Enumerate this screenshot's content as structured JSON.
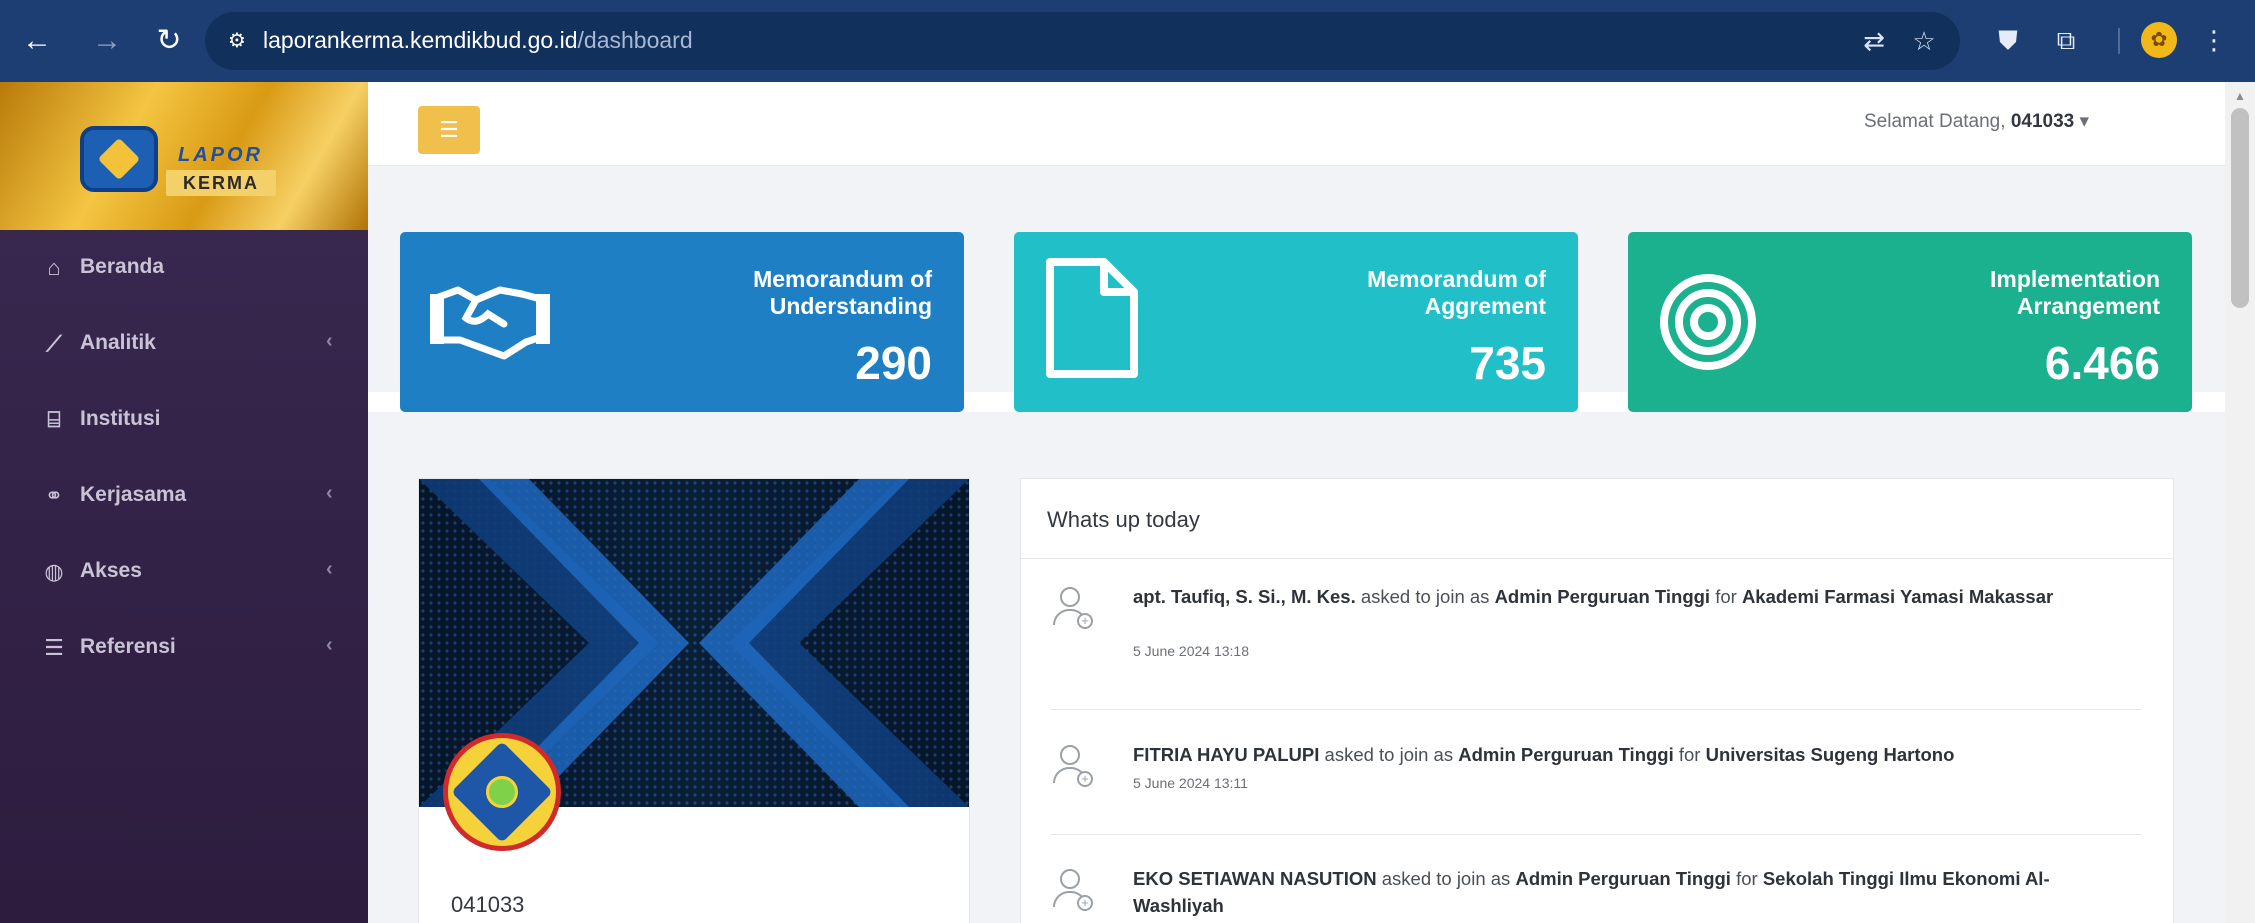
{
  "browser": {
    "url_host": "laporankerma.kemdikbud.go.id",
    "url_path": "/dashboard"
  },
  "logo": {
    "line1": "LAPOR",
    "line2": "KERMA"
  },
  "sidebar": {
    "items": [
      {
        "label": "Beranda",
        "icon": "home-icon",
        "has_submenu": false
      },
      {
        "label": "Analitik",
        "icon": "chart-line-icon",
        "has_submenu": true
      },
      {
        "label": "Institusi",
        "icon": "institution-icon",
        "has_submenu": false
      },
      {
        "label": "Kerjasama",
        "icon": "handshake-icon",
        "has_submenu": true
      },
      {
        "label": "Akses",
        "icon": "globe-icon",
        "has_submenu": true
      },
      {
        "label": "Referensi",
        "icon": "database-icon",
        "has_submenu": true
      }
    ]
  },
  "header": {
    "welcome_prefix": "Selamat Datang, ",
    "username": "041033",
    "caret": "▾"
  },
  "stats": [
    {
      "title": "Memorandum of Understanding",
      "value": "290",
      "color": "#1f7fc4",
      "icon": "handshake-icon"
    },
    {
      "title": "Memorandum of Aggrement",
      "value": "735",
      "color": "#21c0c8",
      "icon": "document-icon"
    },
    {
      "title": "Implementation Arrangement",
      "value": "6.466",
      "color": "#1bb08e",
      "icon": "target-icon"
    }
  ],
  "profile": {
    "id": "041033"
  },
  "feed": {
    "title": "Whats up today",
    "items": [
      {
        "name": "apt. Taufiq, S. Si., M. Kes.",
        "mid": " asked to join as ",
        "role": "Admin Perguruan Tinggi",
        "for": " for ",
        "institution": "Akademi Farmasi Yamasi Makassar",
        "time": "5 June 2024 13:18"
      },
      {
        "name": "FITRIA HAYU PALUPI",
        "mid": " asked to join as ",
        "role": "Admin Perguruan Tinggi",
        "for": " for ",
        "institution": "Universitas Sugeng Hartono",
        "time": "5 June 2024 13:11"
      },
      {
        "name": "EKO SETIAWAN NASUTION",
        "mid": " asked to join as ",
        "role": "Admin Perguruan Tinggi",
        "for": " for ",
        "institution": "Sekolah Tinggi Ilmu Ekonomi Al-Washliyah",
        "time": ""
      }
    ]
  }
}
